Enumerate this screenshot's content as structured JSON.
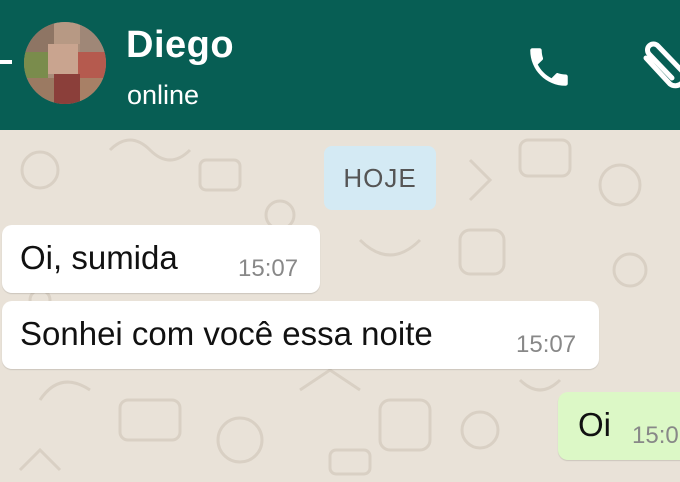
{
  "header": {
    "contact_name": "Diego",
    "status": "online",
    "icons": [
      "back-arrow-icon",
      "avatar",
      "call-icon",
      "attach-clip-icon"
    ],
    "background_color": "#075e54"
  },
  "chat": {
    "date_chip": "HOJE",
    "messages": [
      {
        "direction": "incoming",
        "text": "Oi,  sumida",
        "time": "15:07"
      },
      {
        "direction": "incoming",
        "text": "Sonhei com você essa noite",
        "time": "15:07"
      },
      {
        "direction": "outgoing",
        "text": "Oi",
        "time": "15:0"
      }
    ],
    "colors": {
      "incoming": "#ffffff",
      "outgoing": "#dcf8c6",
      "wallpaper": "#e9e2d8"
    }
  }
}
